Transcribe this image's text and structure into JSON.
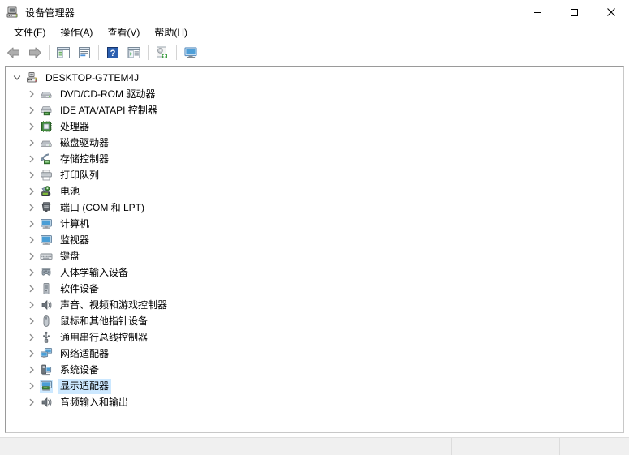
{
  "window": {
    "title": "设备管理器",
    "icon": "device-manager-icon",
    "controls": {
      "minimize": "最小化",
      "maximize": "最大化",
      "close": "关闭"
    }
  },
  "menubar": {
    "items": [
      {
        "label": "文件(F)",
        "name": "menu-file"
      },
      {
        "label": "操作(A)",
        "name": "menu-action"
      },
      {
        "label": "查看(V)",
        "name": "menu-view"
      },
      {
        "label": "帮助(H)",
        "name": "menu-help"
      }
    ]
  },
  "toolbar": {
    "items": [
      {
        "name": "back-icon",
        "title": "后退",
        "enabled": false
      },
      {
        "name": "forward-icon",
        "title": "前进",
        "enabled": false
      },
      {
        "name": "separator",
        "title": ""
      },
      {
        "name": "show-hide-console-tree-icon",
        "title": "显示/隐藏控制台树"
      },
      {
        "name": "properties-icon",
        "title": "属性"
      },
      {
        "name": "separator",
        "title": ""
      },
      {
        "name": "help-icon",
        "title": "帮助"
      },
      {
        "name": "scan-hardware-changes-icon",
        "title": "扫描检测硬件改动"
      },
      {
        "name": "separator",
        "title": ""
      },
      {
        "name": "update-driver-icon",
        "title": "更新驱动程序"
      },
      {
        "name": "separator",
        "title": ""
      },
      {
        "name": "display-device-icon",
        "title": "显示设备"
      }
    ]
  },
  "tree": {
    "root": {
      "label": "DESKTOP-G7TEM4J",
      "icon": "computer-root-icon",
      "expanded": true,
      "selected": false
    },
    "nodes": [
      {
        "label": "DVD/CD-ROM 驱动器",
        "icon": "dvd-drive-icon",
        "expanded": false,
        "selected": false
      },
      {
        "label": "IDE ATA/ATAPI 控制器",
        "icon": "ide-controller-icon",
        "expanded": false,
        "selected": false
      },
      {
        "label": "处理器",
        "icon": "processor-icon",
        "expanded": false,
        "selected": false
      },
      {
        "label": "磁盘驱动器",
        "icon": "disk-drive-icon",
        "expanded": false,
        "selected": false
      },
      {
        "label": "存储控制器",
        "icon": "storage-controller-icon",
        "expanded": false,
        "selected": false
      },
      {
        "label": "打印队列",
        "icon": "printer-icon",
        "expanded": false,
        "selected": false
      },
      {
        "label": "电池",
        "icon": "battery-icon",
        "expanded": false,
        "selected": false
      },
      {
        "label": "端口 (COM 和 LPT)",
        "icon": "port-icon",
        "expanded": false,
        "selected": false
      },
      {
        "label": "计算机",
        "icon": "computer-icon",
        "expanded": false,
        "selected": false
      },
      {
        "label": "监视器",
        "icon": "monitor-icon",
        "expanded": false,
        "selected": false
      },
      {
        "label": "键盘",
        "icon": "keyboard-icon",
        "expanded": false,
        "selected": false
      },
      {
        "label": "人体学输入设备",
        "icon": "hid-icon",
        "expanded": false,
        "selected": false
      },
      {
        "label": "软件设备",
        "icon": "software-device-icon",
        "expanded": false,
        "selected": false
      },
      {
        "label": "声音、视频和游戏控制器",
        "icon": "sound-icon",
        "expanded": false,
        "selected": false
      },
      {
        "label": "鼠标和其他指针设备",
        "icon": "mouse-icon",
        "expanded": false,
        "selected": false
      },
      {
        "label": "通用串行总线控制器",
        "icon": "usb-icon",
        "expanded": false,
        "selected": false
      },
      {
        "label": "网络适配器",
        "icon": "network-adapter-icon",
        "expanded": false,
        "selected": false
      },
      {
        "label": "系统设备",
        "icon": "system-device-icon",
        "expanded": false,
        "selected": false
      },
      {
        "label": "显示适配器",
        "icon": "display-adapter-icon",
        "expanded": false,
        "selected": true
      },
      {
        "label": "音频输入和输出",
        "icon": "audio-io-icon",
        "expanded": false,
        "selected": false
      }
    ]
  },
  "statusbar": {
    "cells": [
      "",
      "",
      ""
    ]
  },
  "colors": {
    "selection": "#cce8ff",
    "window_bg": "#ffffff",
    "statusbar_bg": "#f0f0f0",
    "panel_border": "#9a9a9a",
    "text": "#000000"
  }
}
